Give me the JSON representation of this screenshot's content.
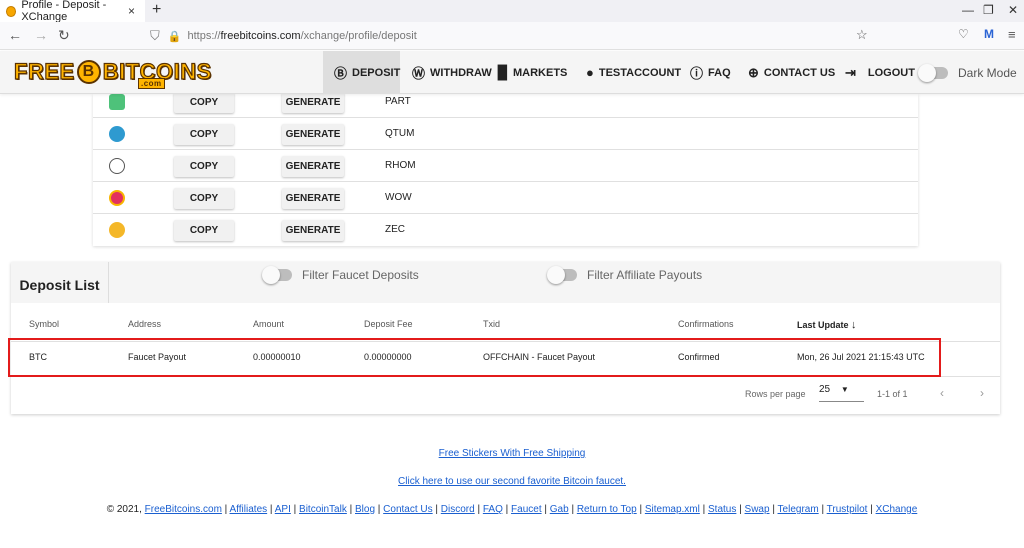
{
  "browser": {
    "tab_title": "Profile - Deposit - XChange",
    "url_prefix": "https://",
    "url_host": "freebitcoins.com",
    "url_path": "/xchange/profile/deposit"
  },
  "logo": {
    "free": "FREE",
    "coin": "B",
    "bitcoins": "BITCOINS",
    "dotcom": ".com"
  },
  "menu": [
    {
      "label": "DEPOSIT",
      "icon": "deposit-icon"
    },
    {
      "label": "WITHDRAW",
      "icon": "withdraw-icon"
    },
    {
      "label": "MARKETS",
      "icon": "markets-icon"
    },
    {
      "label": "TESTACCOUNT",
      "icon": "person-icon"
    },
    {
      "label": "FAQ",
      "icon": "help-icon"
    },
    {
      "label": "CONTACT US",
      "icon": "support-icon"
    },
    {
      "label": "LOGOUT",
      "icon": "logout-icon"
    },
    {
      "label": "Dark Mode",
      "icon": "toggle-icon"
    }
  ],
  "coins": [
    {
      "symbol": "PART",
      "copy": "COPY",
      "generate": "GENERATE",
      "color": "#4ec27a"
    },
    {
      "symbol": "QTUM",
      "copy": "COPY",
      "generate": "GENERATE",
      "color": "#2e9ad0"
    },
    {
      "symbol": "RHOM",
      "copy": "COPY",
      "generate": "GENERATE",
      "color": "#ffffff"
    },
    {
      "symbol": "WOW",
      "copy": "COPY",
      "generate": "GENERATE",
      "color": "#e2315f"
    },
    {
      "symbol": "ZEC",
      "copy": "COPY",
      "generate": "GENERATE",
      "color": "#f4b728"
    }
  ],
  "deposit_list": {
    "title": "Deposit List",
    "filter_faucet": "Filter Faucet Deposits",
    "filter_affiliate": "Filter Affiliate Payouts",
    "columns": [
      "Symbol",
      "Address",
      "Amount",
      "Deposit Fee",
      "Txid",
      "Confirmations",
      "Last Update"
    ],
    "sort_arrow": "↓",
    "row": {
      "symbol": "BTC",
      "address": "Faucet Payout",
      "amount": "0.00000010",
      "fee": "0.00000000",
      "txid": "OFFCHAIN - Faucet Payout",
      "confirmations": "Confirmed",
      "last_update": "Mon, 26 Jul 2021 21:15:43 UTC"
    },
    "rows_per_page_label": "Rows per page",
    "rows_per_page": "25",
    "range": "1-1 of 1"
  },
  "footer": {
    "stickers": "Free Stickers With Free Shipping",
    "second_faucet": "Click here to use our second favorite Bitcoin faucet.",
    "copyright": "© 2021, ",
    "links": [
      "FreeBitcoins.com",
      "Affiliates",
      "API",
      "BitcoinTalk",
      "Blog",
      "Contact Us",
      "Discord",
      "FAQ",
      "Faucet",
      "Gab",
      "Return to Top",
      "Sitemap.xml",
      "Status",
      "Swap",
      "Telegram",
      "Trustpilot",
      "XChange"
    ]
  }
}
